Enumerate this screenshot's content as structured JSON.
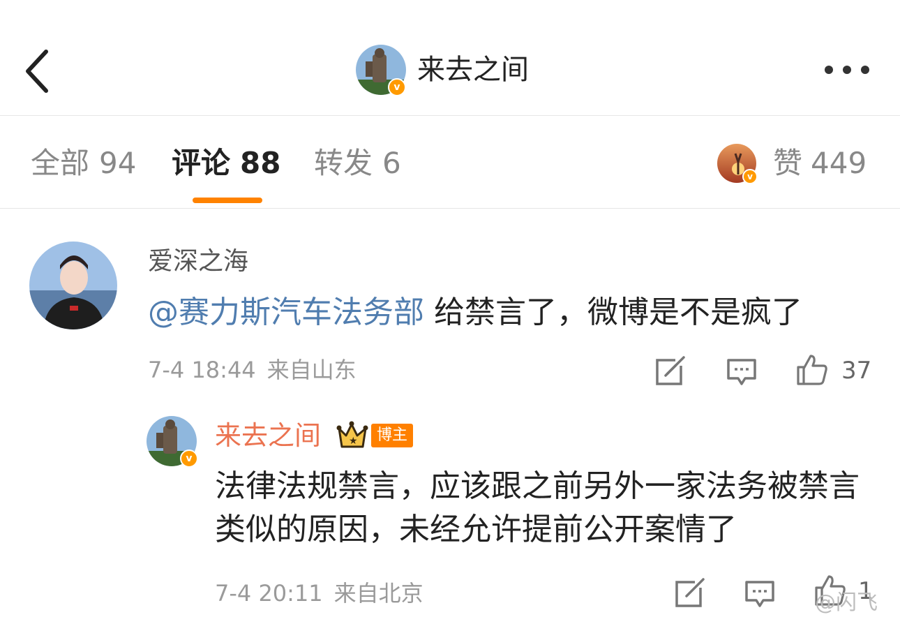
{
  "header": {
    "title": "来去之间",
    "verified_badge": "v",
    "back_icon": "chevron-left-icon",
    "more_icon": "more-horizontal-icon"
  },
  "tabs": {
    "all": {
      "label": "全部",
      "count": "94"
    },
    "comments": {
      "label": "评论",
      "count": "88"
    },
    "reposts": {
      "label": "转发",
      "count": "6"
    },
    "likes": {
      "label": "赞",
      "count": "449"
    },
    "active_color": "#ff8200"
  },
  "comment": {
    "username": "爱深之海",
    "mention": "@赛力斯汽车法务部",
    "text": " 给禁言了，微博是不是疯了",
    "time": "7-4 18:44",
    "source": "来自山东",
    "like_count": "37"
  },
  "reply": {
    "username": "来去之间",
    "badge": "博主",
    "verified_badge": "v",
    "text": "法律法规禁言，应该跟之前另外一家法务被禁言类似的原因，未经允许提前公开案情了",
    "time": "7-4 20:11",
    "source": "来自北京",
    "like_count": "1"
  },
  "watermark": "@闪飞",
  "colors": {
    "mention": "#507daf",
    "author_name": "#eb7350",
    "badge_bg": "#ff8000",
    "verified": "#ff9a00"
  }
}
